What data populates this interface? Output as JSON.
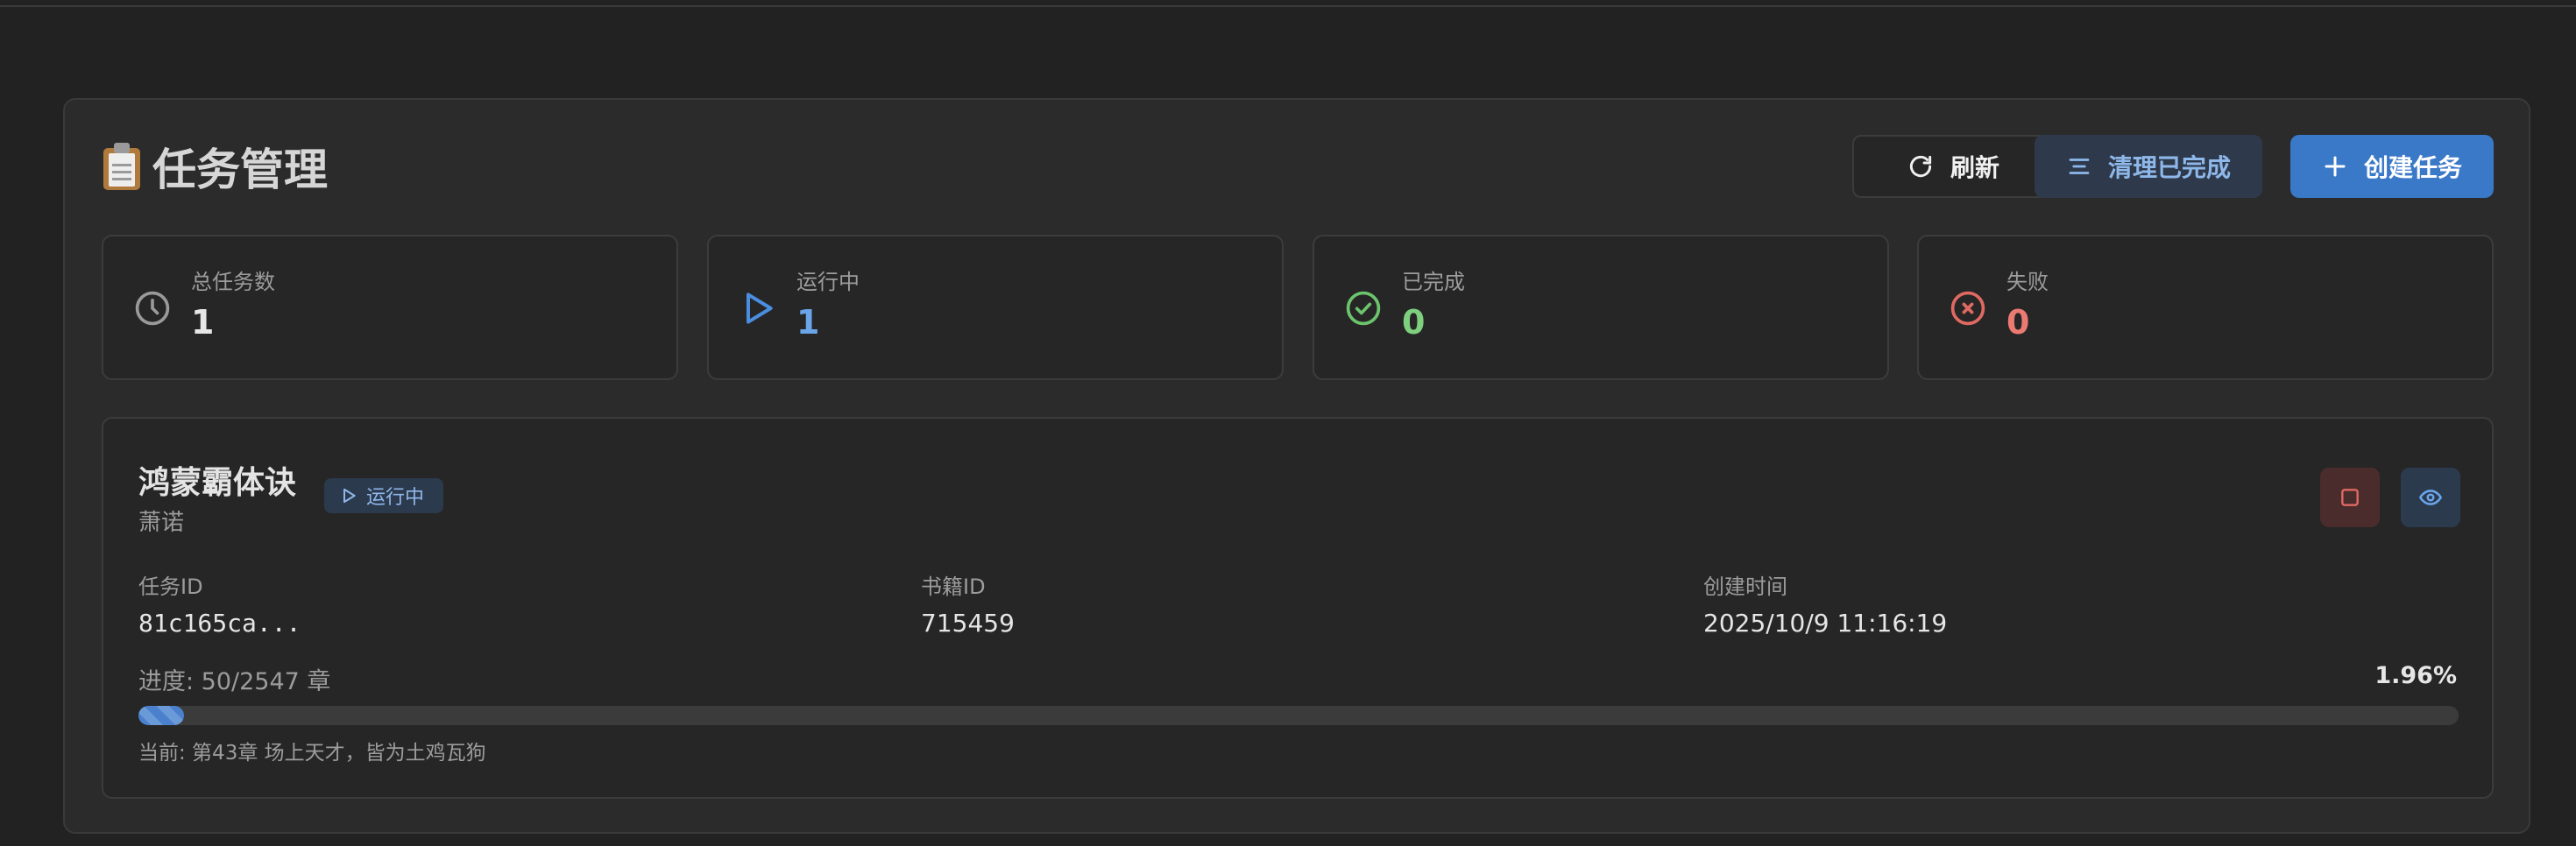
{
  "header": {
    "icon": "clipboard-icon",
    "title": "任务管理"
  },
  "toolbar": {
    "refresh_label": "刷新",
    "clear_label": "清理已完成",
    "create_label": "创建任务"
  },
  "stats": [
    {
      "label": "总任务数",
      "value": "1",
      "icon": "clock-icon",
      "color": "#e6e6e6",
      "icon_color": "#9a9a9a"
    },
    {
      "label": "运行中",
      "value": "1",
      "icon": "play-icon",
      "color": "#6aa5ea",
      "icon_color": "#4a8ee0"
    },
    {
      "label": "已完成",
      "value": "0",
      "icon": "check-circle-icon",
      "color": "#7ed07e",
      "icon_color": "#6cc46c"
    },
    {
      "label": "失败",
      "value": "0",
      "icon": "x-circle-icon",
      "color": "#ec7a72",
      "icon_color": "#e06a62"
    }
  ],
  "task": {
    "title": "鸿蒙霸体诀",
    "author": "萧诺",
    "status": "运行中",
    "meta": [
      {
        "key": "任务ID",
        "value": "81c165ca..."
      },
      {
        "key": "书籍ID",
        "value": "715459"
      },
      {
        "key": "创建时间",
        "value": "2025/10/9 11:16:19"
      }
    ],
    "progress_label": "进度: 50/2547 章",
    "progress_percent_text": "1.96%",
    "progress_fraction": 0.0196,
    "current_chapter": "当前: 第43章 场上天才，皆为土鸡瓦狗"
  },
  "colors": {
    "accent": "#3a78c8",
    "running": "#8fb8ea",
    "stop": "#e06a62"
  }
}
